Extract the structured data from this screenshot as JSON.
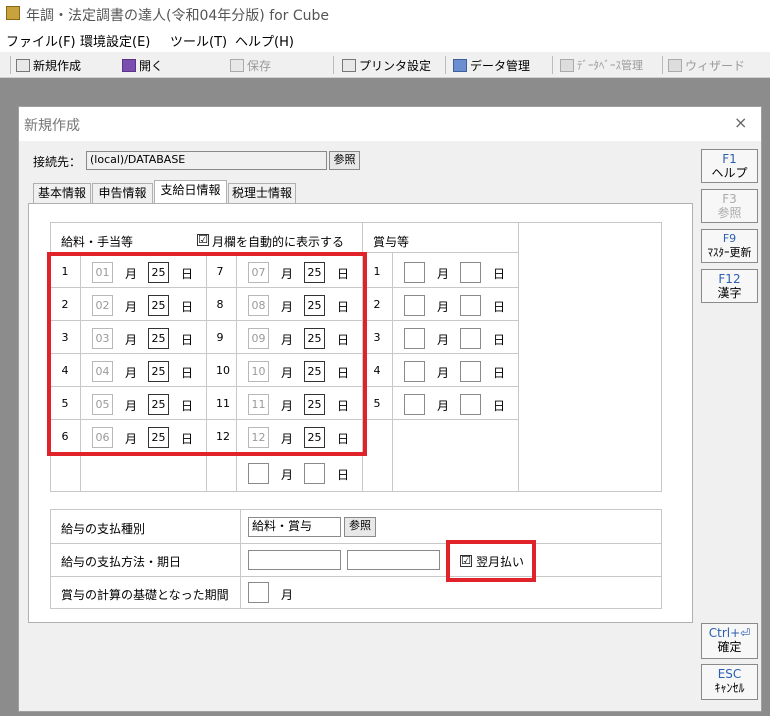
{
  "window": {
    "title": "年調・法定調書の達人(令和04年分版) for Cube"
  },
  "menu": [
    "ファイル(F)",
    "環境設定(E)",
    "ツール(T)",
    "ヘルプ(H)"
  ],
  "toolbar": {
    "new": "新規作成",
    "open": "開く",
    "save": "保存",
    "printer": "プリンタ設定",
    "data": "データ管理",
    "db": "ﾃﾞｰﾀﾍﾞｰｽ管理",
    "wizard": "ウィザード"
  },
  "dialog": {
    "title": "新規作成",
    "close": "×",
    "connection_label": "接続先：",
    "connection_value": "(local)/DATABASE",
    "ref_button": "参照",
    "tabs": [
      "基本情報",
      "申告情報",
      "支給日情報",
      "税理士情報"
    ],
    "salary_header": "給料・手当等",
    "auto_display_label": "月欄を自動的に表示する",
    "auto_display_checked": "☑",
    "bonus_header": "賞与等",
    "month_unit": "月",
    "day_unit": "日",
    "salary_rows": [
      {
        "n": "1",
        "m": "01",
        "d": "25"
      },
      {
        "n": "2",
        "m": "02",
        "d": "25"
      },
      {
        "n": "3",
        "m": "03",
        "d": "25"
      },
      {
        "n": "4",
        "m": "04",
        "d": "25"
      },
      {
        "n": "5",
        "m": "05",
        "d": "25"
      },
      {
        "n": "6",
        "m": "06",
        "d": "25"
      }
    ],
    "salary_rows2": [
      {
        "n": "7",
        "m": "07",
        "d": "25"
      },
      {
        "n": "8",
        "m": "08",
        "d": "25"
      },
      {
        "n": "9",
        "m": "09",
        "d": "25"
      },
      {
        "n": "10",
        "m": "10",
        "d": "25"
      },
      {
        "n": "11",
        "m": "11",
        "d": "25"
      },
      {
        "n": "12",
        "m": "12",
        "d": "25"
      }
    ],
    "bonus_rows": [
      "1",
      "2",
      "3",
      "4",
      "5"
    ],
    "pay_type_label": "給与の支払種別",
    "pay_type_value": "給料・賞与",
    "pay_method_label": "給与の支払方法・期日",
    "next_month_label": "翌月払い",
    "bonus_period_label": "賞与の計算の基礎となった期間"
  },
  "side_buttons": [
    {
      "key": "F1",
      "label": "ヘルプ"
    },
    {
      "key": "F3",
      "label": "参照"
    },
    {
      "key": "F9",
      "label": "ﾏｽﾀｰ更新"
    },
    {
      "key": "F12",
      "label": "漢字"
    },
    {
      "key": "Ctrl+⏎",
      "label": "確定"
    },
    {
      "key": "ESC",
      "label": "ｷｬﾝｾﾙ"
    }
  ]
}
